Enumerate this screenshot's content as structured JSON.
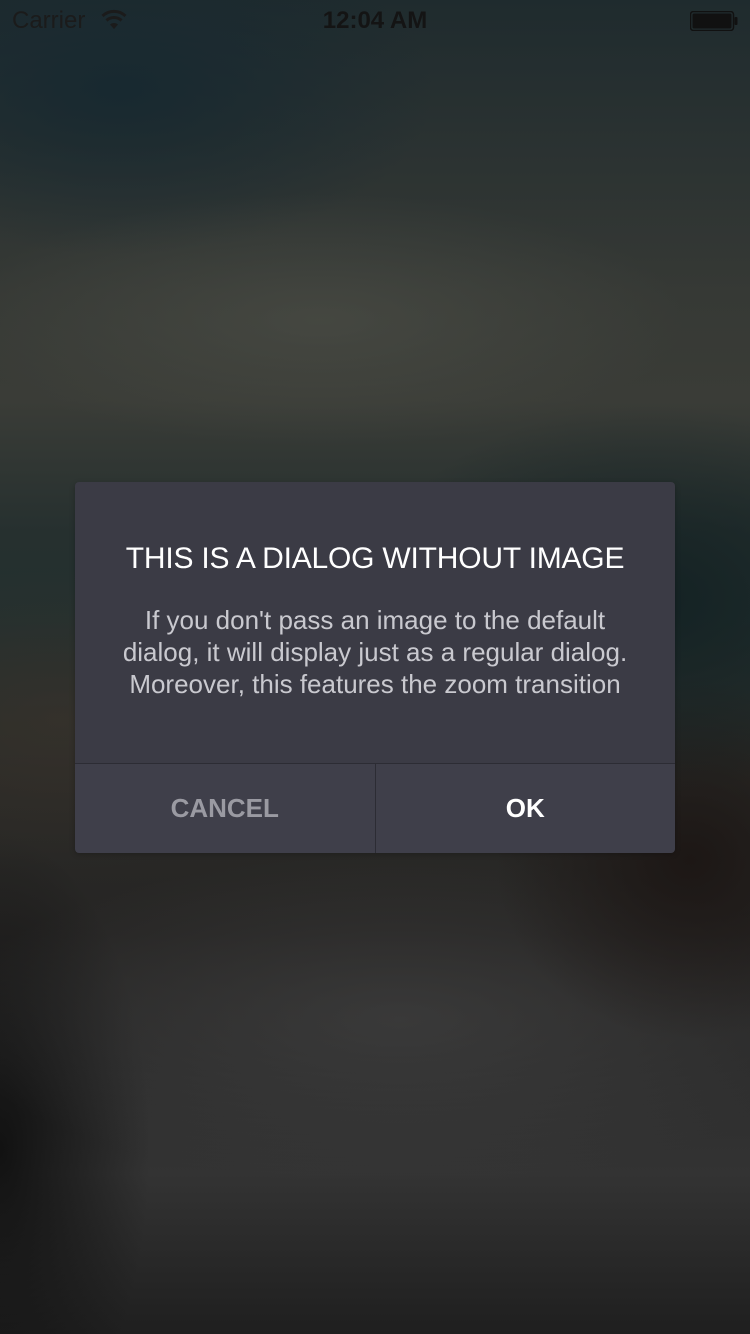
{
  "status_bar": {
    "carrier": "Carrier",
    "time": "12:04 AM",
    "wifi_icon": "wifi-icon",
    "battery_icon": "battery-icon"
  },
  "dialog": {
    "title": "THIS IS A DIALOG WITHOUT IMAGE",
    "message_lines": [
      "If you don't pass an image to the default",
      "dialog, it will display just as a regular dialog.",
      "Moreover, this features the zoom transition"
    ],
    "cancel_label": "CANCEL",
    "ok_label": "OK"
  },
  "colors": {
    "dialog_background": "#3b3b45",
    "cancel_text": "#9a9aa2",
    "ok_text": "#ffffff"
  }
}
